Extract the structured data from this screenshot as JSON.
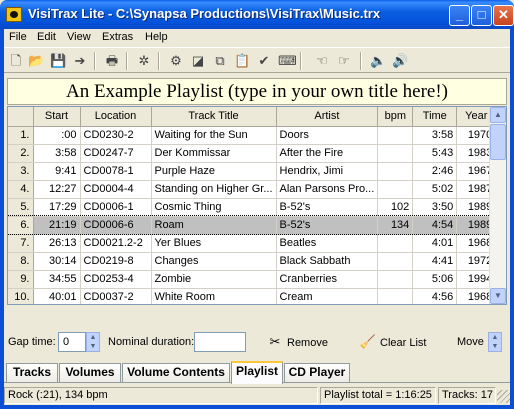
{
  "window": {
    "title": "VisiTrax Lite - C:\\Synapsa Productions\\VisiTrax\\Music.trx",
    "min_glyph": "_",
    "max_glyph": "□",
    "close_glyph": "✕"
  },
  "menu": [
    "File",
    "Edit",
    "View",
    "Extras",
    "Help"
  ],
  "toolbar_icons": [
    "new-file-icon",
    "open-folder-icon",
    "save-icon",
    "export-icon",
    "print-icon",
    "shuffle-icon",
    "cd-wizard-icon",
    "label-icon",
    "copy-icon",
    "paste-icon",
    "check-icon",
    "keyboard-icon",
    "hand-left-icon",
    "hand-right-icon",
    "speaker-icon",
    "speaker-loud-icon"
  ],
  "playlist_title": "An Example Playlist (type in your own title here!)",
  "columns": [
    "",
    "Start",
    "Location",
    "Track Title",
    "Artist",
    "bpm",
    "Time",
    "Year"
  ],
  "rows": [
    {
      "n": "1.",
      "start": ":00",
      "loc": "CD0230-2",
      "title": "Waiting for the Sun",
      "artist": "Doors",
      "bpm": "",
      "time": "3:58",
      "year": "1970"
    },
    {
      "n": "2.",
      "start": "3:58",
      "loc": "CD0247-7",
      "title": "Der Kommissar",
      "artist": "After the Fire",
      "bpm": "",
      "time": "5:43",
      "year": "1983"
    },
    {
      "n": "3.",
      "start": "9:41",
      "loc": "CD0078-1",
      "title": "Purple Haze",
      "artist": "Hendrix, Jimi",
      "bpm": "",
      "time": "2:46",
      "year": "1967"
    },
    {
      "n": "4.",
      "start": "12:27",
      "loc": "CD0004-4",
      "title": "Standing on Higher Gr...",
      "artist": "Alan Parsons Pro...",
      "bpm": "",
      "time": "5:02",
      "year": "1987"
    },
    {
      "n": "5.",
      "start": "17:29",
      "loc": "CD0006-1",
      "title": "Cosmic Thing",
      "artist": "B-52's",
      "bpm": "102",
      "time": "3:50",
      "year": "1989"
    },
    {
      "n": "6.",
      "start": "21:19",
      "loc": "CD0006-6",
      "title": "Roam",
      "artist": "B-52's",
      "bpm": "134",
      "time": "4:54",
      "year": "1989",
      "selected": true
    },
    {
      "n": "7.",
      "start": "26:13",
      "loc": "CD0021.2-2",
      "title": "Yer Blues",
      "artist": "Beatles",
      "bpm": "",
      "time": "4:01",
      "year": "1968"
    },
    {
      "n": "8.",
      "start": "30:14",
      "loc": "CD0219-8",
      "title": "Changes",
      "artist": "Black Sabbath",
      "bpm": "",
      "time": "4:41",
      "year": "1972"
    },
    {
      "n": "9.",
      "start": "34:55",
      "loc": "CD0253-4",
      "title": "Zombie",
      "artist": "Cranberries",
      "bpm": "",
      "time": "5:06",
      "year": "1994"
    },
    {
      "n": "10.",
      "start": "40:01",
      "loc": "CD0037-2",
      "title": "White Room",
      "artist": "Cream",
      "bpm": "",
      "time": "4:56",
      "year": "1968"
    }
  ],
  "controls": {
    "gap_label": "Gap time:",
    "gap_value": "0",
    "nominal_label": "Nominal duration:",
    "nominal_value": "",
    "remove_label": "Remove",
    "clear_label": "Clear List",
    "move_label": "Move"
  },
  "tabs": [
    {
      "label": "Tracks",
      "active": false
    },
    {
      "label": "Volumes",
      "active": false
    },
    {
      "label": "Volume Contents",
      "active": false
    },
    {
      "label": "Playlist",
      "active": true
    },
    {
      "label": "CD Player",
      "active": false
    }
  ],
  "status": {
    "left": "Rock (:21), 134 bpm",
    "total": "Playlist total = 1:16:25",
    "tracks": "Tracks: 17"
  }
}
